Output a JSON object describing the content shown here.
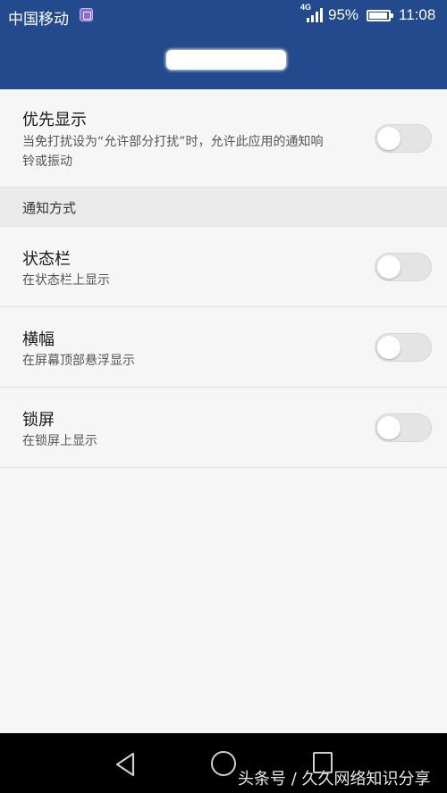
{
  "status_bar": {
    "carrier": "中国移动",
    "network_type": "4G",
    "battery_percent": "95%",
    "battery_level": 0.95,
    "time": "11:08",
    "icons": [
      "gallery-notification-icon",
      "signal-icon",
      "battery-icon"
    ]
  },
  "colors": {
    "app_bar": "#234a8c",
    "background": "#f6f6f6",
    "toggle_off": "#e4e4e4"
  },
  "priority": {
    "title": "优先显示",
    "subtitle_line1": "当免打扰设为“允许部分打扰”时，允许此应用的通知响",
    "subtitle_line2": "铃或振动",
    "enabled": false
  },
  "section": {
    "label": "通知方式"
  },
  "status_bar_setting": {
    "title": "状态栏",
    "subtitle": "在状态栏上显示",
    "enabled": false
  },
  "banner_setting": {
    "title": "横幅",
    "subtitle": "在屏幕顶部悬浮显示",
    "enabled": false
  },
  "lockscreen_setting": {
    "title": "锁屏",
    "subtitle": "在锁屏上显示",
    "enabled": false
  },
  "nav": {
    "watermark": "头条号 / 久久网络知识分享"
  }
}
